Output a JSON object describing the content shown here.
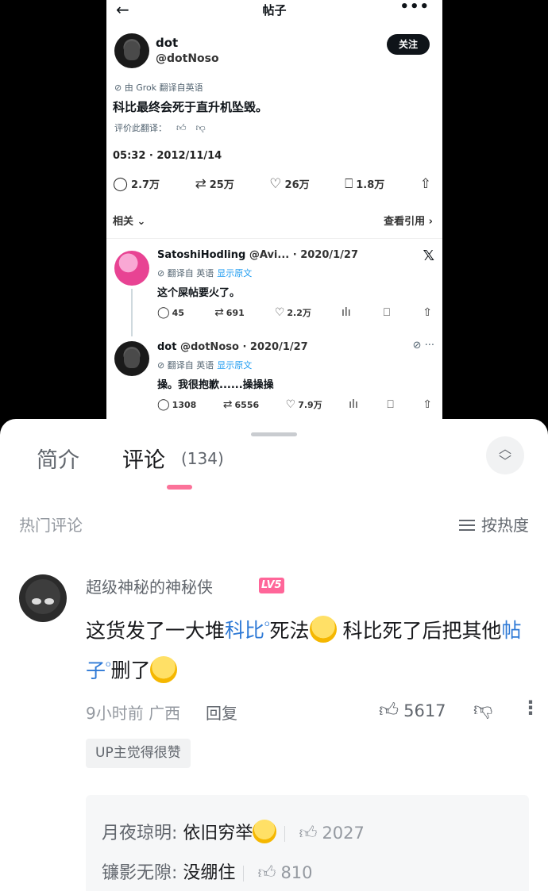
{
  "tweet": {
    "header_title": "帖子",
    "back_icon": "←",
    "more_icon": "•••",
    "author_name": "dot",
    "author_handle": "@dotNoso",
    "follow_label": "关注",
    "translated_note": "由 Grok 翻译自英语",
    "text": "科比最终会死于直升机坠毁。",
    "rate_label": "评价此翻译：",
    "timestamp": "05:32 · 2012/11/14",
    "stats": {
      "replies": "2.7万",
      "retweets": "25万",
      "likes": "26万",
      "bookmarks": "1.8万"
    },
    "related_label": "相关",
    "quotes_label": "查看引用 ›",
    "replies": [
      {
        "name": "SatoshiHodling",
        "meta": "@Avi... · 2020/1/27",
        "trans": "翻译自 英语",
        "show_original": "显示原文",
        "text": "这个屎帖要火了。",
        "replies": "45",
        "retweets": "691",
        "likes": "2.2万"
      },
      {
        "name": "dot",
        "meta": "@dotNoso · 2020/1/27",
        "trans": "翻译自 英语",
        "show_original": "显示原文",
        "text": "操。我很抱歉......操操操",
        "replies": "1308",
        "retweets": "6556",
        "likes": "7.9万"
      }
    ]
  },
  "panel": {
    "tab_intro": "简介",
    "tab_comments": "评论",
    "comment_count": "(134)",
    "hot_label": "热门评论",
    "sort_label": "按热度",
    "comment": {
      "username": "超级神秘的神秘侠",
      "level": "LV5",
      "text_1": "这货发了一大堆",
      "keyword_1": "科比",
      "text_2": "死法",
      "text_3": "科比死了后把其他",
      "keyword_2": "帖子",
      "text_4": "删了",
      "time_location": "9小时前  广西",
      "reply_label": "回复",
      "likes": "5617",
      "up_badge": "UP主觉得很赞"
    },
    "sub_comments": [
      {
        "user": "月夜琼明:",
        "text": "依旧穷举",
        "likes": "2027"
      },
      {
        "user": "镰影无隙:",
        "text": "没绷住",
        "likes": "810"
      }
    ]
  },
  "colors": {
    "accent_pink": "#fb7299",
    "link_blue": "#2f7ad6",
    "level_badge": "#ff6699"
  }
}
